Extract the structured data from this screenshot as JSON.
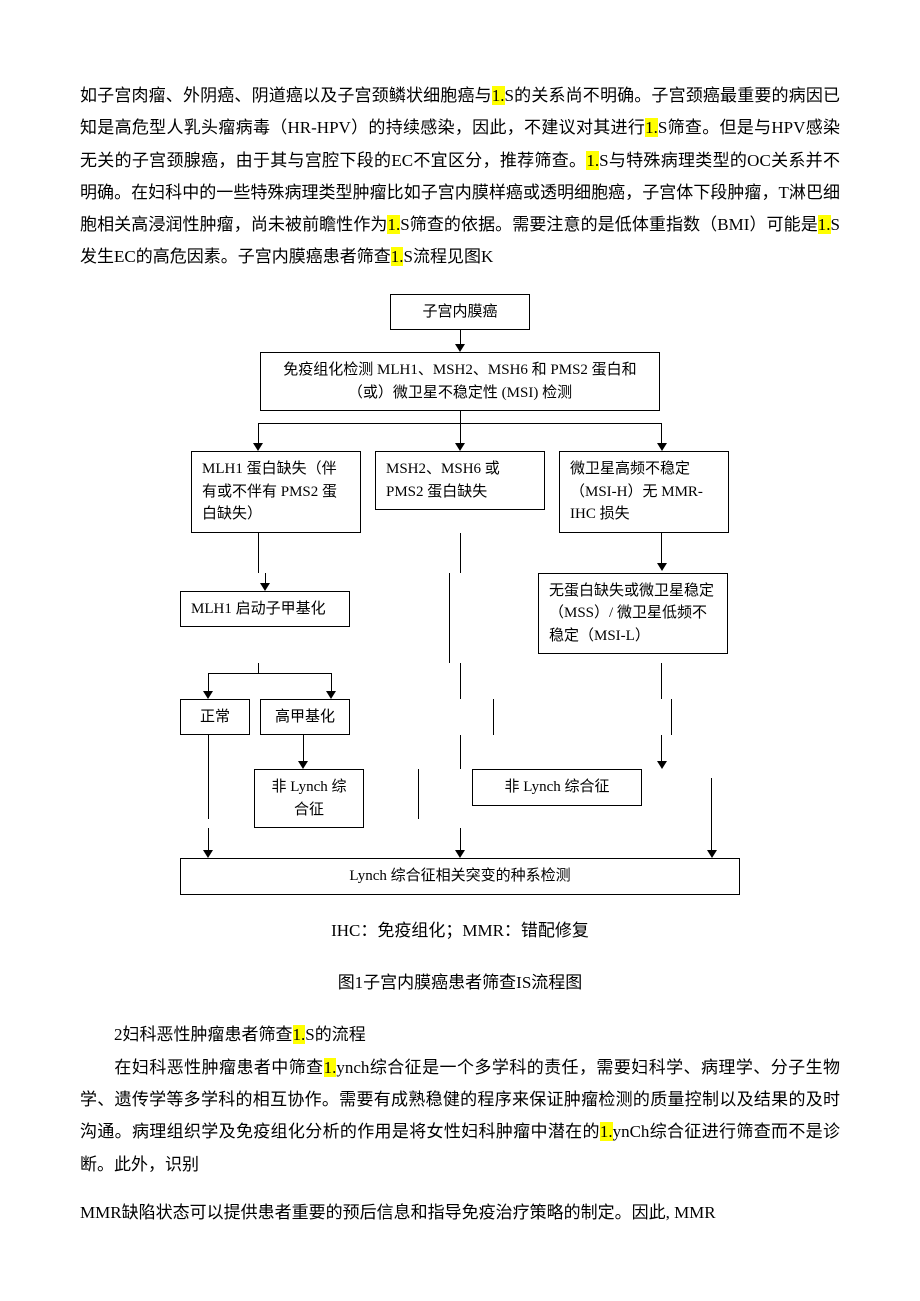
{
  "para1": {
    "t1": "如子宫肉瘤、外阴癌、阴道癌以及子宫颈鳞状细胞癌与",
    "h1": "1.",
    "t2": "S的关系尚不明确。子宫颈癌最重要的病因已知是高危型人乳头瘤病毒（HR-HPV）的持续感染，因此，不建议对其进行",
    "h2": "1.",
    "t3": "S筛查。但是与HPV感染无关的子宫颈腺癌，由于其与宫腔下段的EC不宜区分，推荐筛查。",
    "h3": "1.",
    "t4": "S与特殊病理类型的OC关系并不明确。在妇科中的一些特殊病理类型肿瘤比如子宫内膜样癌或透明细胞癌，子宫体下段肿瘤，T淋巴细胞相关高浸润性肿瘤，尚未被前瞻性作为",
    "h4": "1.",
    "t5": "S筛查的依据。需要注意的是低体重指数（BMI）可能是",
    "h5": "1.",
    "t6": "S发生EC的高危因素。子宫内膜癌患者筛查",
    "h6": "1.",
    "t7": "S流程见图K"
  },
  "flow": {
    "top": "子宫内膜癌",
    "ihc": "免疫组化检测 MLH1、MSH2、MSH6 和 PMS2 蛋白和（或）微卫星不稳定性 (MSI) 检测",
    "b_mlh1_loss": "MLH1 蛋白缺失（伴有或不伴有 PMS2 蛋白缺失）",
    "b_msh_loss": "MSH2、MSH6 或 PMS2 蛋白缺失",
    "b_msih": "微卫星高频不稳定（MSI-H）无 MMR-IHC 损失",
    "b_mss": "无蛋白缺失或微卫星稳定（MSS）/ 微卫星低频不稳定（MSI-L）",
    "b_methyl": "MLH1 启动子甲基化",
    "b_normal": "正常",
    "b_hyper": "高甲基化",
    "b_nonlynch1": "非 Lynch 综合征",
    "b_nonlynch2": "非 Lynch 综合征",
    "b_germline": "Lynch 综合征相关突变的种系检测"
  },
  "caption": "IHC：免疫组化；MMR：错配修复",
  "figtitle": "图1子宫内膜癌患者筛查IS流程图",
  "sec2": {
    "title_a": "2妇科恶性肿瘤患者筛查",
    "title_h": "1.",
    "title_b": "S的流程",
    "p1a": "在妇科恶性肿瘤患者中筛查",
    "p1h": "1.",
    "p1b": "ynch综合征是一个多学科的责任，需要妇科学、病理学、分子生物学、遗传学等多学科的相互协作。需要有成熟稳健的程序来保证肿瘤检测的质量控制以及结果的及时沟通。病理组织学及免疫组化分析的作用是将女性妇科肿瘤中潜在的",
    "p2h": "1.",
    "p2b": "ynCh综合征进行筛查而不是诊断。此外，识别",
    "p3": "MMR缺陷状态可以提供患者重要的预后信息和指导免疫治疗策略的制定。因此, MMR"
  }
}
